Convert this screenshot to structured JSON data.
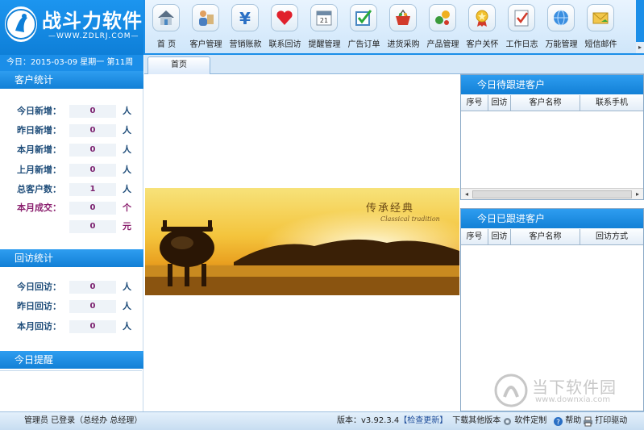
{
  "app": {
    "name": "战斗力软件",
    "url": "WWW.ZDLRJ.COM",
    "date_line": "今日：2015-03-09  星期一  第11周"
  },
  "toolbar": [
    {
      "label": "首 页",
      "icon": "home-icon"
    },
    {
      "label": "客户管理",
      "icon": "customer-icon"
    },
    {
      "label": "营销账款",
      "icon": "yen-icon"
    },
    {
      "label": "联系回访",
      "icon": "heart-icon"
    },
    {
      "label": "提醒管理",
      "icon": "calendar-icon"
    },
    {
      "label": "广告订单",
      "icon": "checkbox-icon"
    },
    {
      "label": "进货采购",
      "icon": "basket-icon"
    },
    {
      "label": "产品管理",
      "icon": "product-icon"
    },
    {
      "label": "客户关怀",
      "icon": "medal-icon"
    },
    {
      "label": "工作日志",
      "icon": "log-icon"
    },
    {
      "label": "万能管理",
      "icon": "globe-icon"
    },
    {
      "label": "短信邮件",
      "icon": "mail-icon"
    }
  ],
  "tab": {
    "label": "首页"
  },
  "customer_stats": {
    "title": "客户统计",
    "rows": [
      {
        "label": "今日新增：",
        "value": "0",
        "unit": "人"
      },
      {
        "label": "昨日新增：",
        "value": "0",
        "unit": "人"
      },
      {
        "label": "本月新增：",
        "value": "0",
        "unit": "人"
      },
      {
        "label": "上月新增：",
        "value": "0",
        "unit": "人"
      },
      {
        "label": "总客户数：",
        "value": "1",
        "unit": "人"
      },
      {
        "label": "本月成交：",
        "value": "0",
        "unit": "个"
      },
      {
        "label": "",
        "value": "0",
        "unit": "元"
      }
    ]
  },
  "visit_stats": {
    "title": "回访统计",
    "rows": [
      {
        "label": "今日回访：",
        "value": "0",
        "unit": "人"
      },
      {
        "label": "昨日回访：",
        "value": "0",
        "unit": "人"
      },
      {
        "label": "本月回访：",
        "value": "0",
        "unit": "人"
      }
    ]
  },
  "reminders": {
    "title": "今日提醒"
  },
  "banner": {
    "title": "传承经典",
    "subtitle": "Classical tradition"
  },
  "pending_followup": {
    "title": "今日待跟进客户",
    "columns": [
      "序号",
      "回访",
      "客户名称",
      "联系手机"
    ]
  },
  "done_followup": {
    "title": "今日已跟进客户",
    "columns": [
      "序号",
      "回访",
      "客户名称",
      "回访方式"
    ]
  },
  "statusbar": {
    "user": "管理员  已登录（总经办  总经理）",
    "version": "版本：v3.92.3.4",
    "check_update": "【检查更新】",
    "other_versions": "下载其他版本",
    "customize": "软件定制",
    "help": "帮助",
    "print_driver": "打印驱动"
  },
  "watermark": {
    "text": "当下软件园",
    "url": "www.downxia.com"
  }
}
